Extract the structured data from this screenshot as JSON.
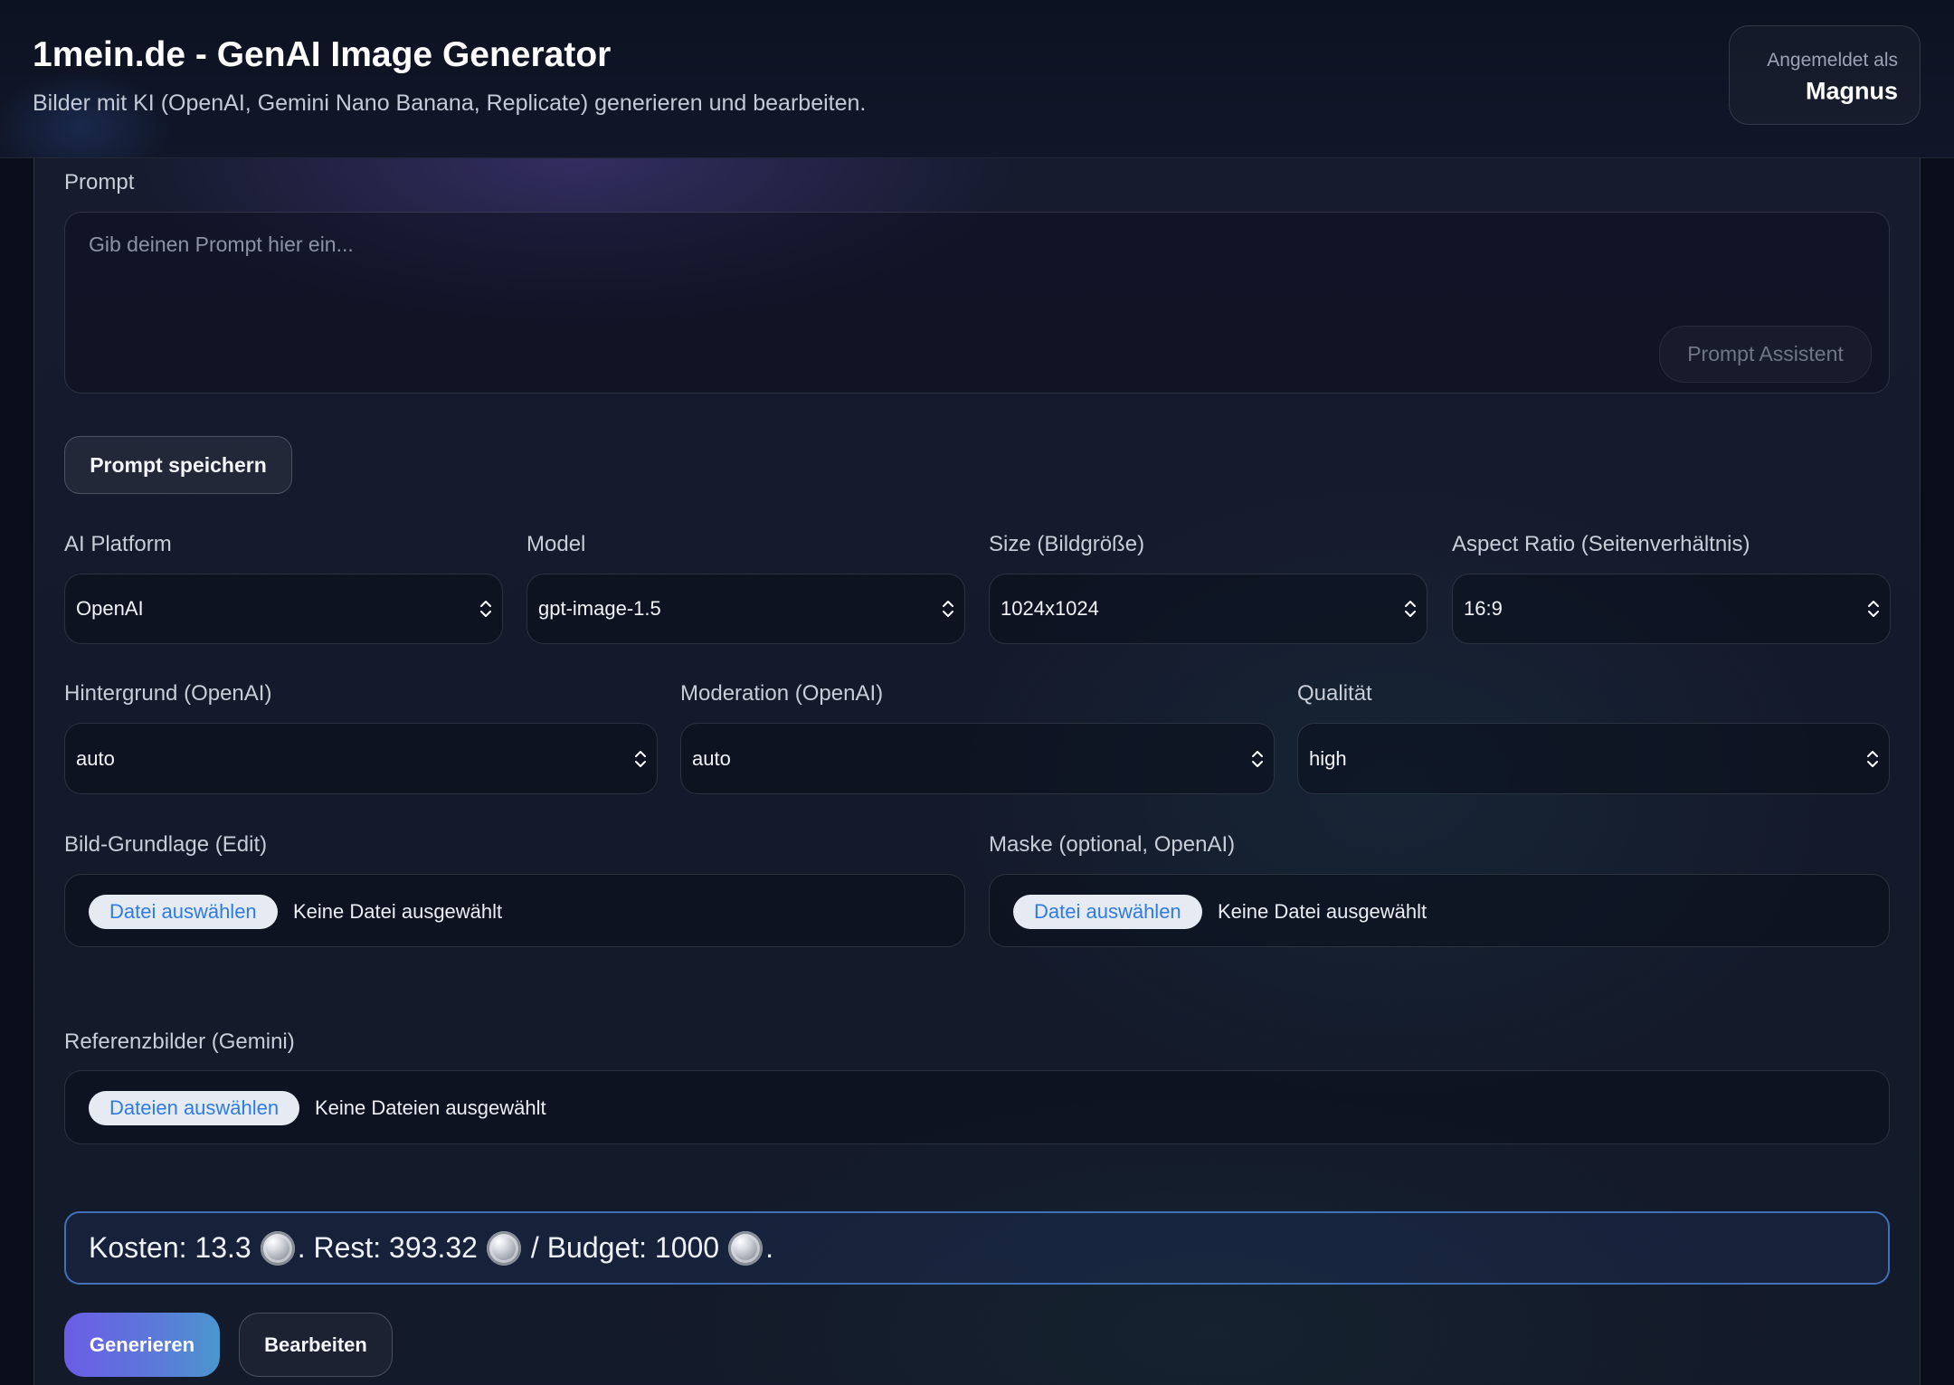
{
  "header": {
    "title": "1mein.de - GenAI Image Generator",
    "subtitle": "Bilder mit KI (OpenAI, Gemini Nano Banana, Replicate) generieren und bearbeiten.",
    "user_label": "Angemeldet als",
    "user_name": "Magnus"
  },
  "prompt": {
    "label": "Prompt",
    "placeholder": "Gib deinen Prompt hier ein...",
    "value": "",
    "assistant_button": "Prompt Assistent",
    "save_button": "Prompt speichern"
  },
  "settings": {
    "row1": [
      {
        "label": "AI Platform",
        "value": "OpenAI"
      },
      {
        "label": "Model",
        "value": "gpt-image-1.5"
      },
      {
        "label": "Size (Bildgröße)",
        "value": "1024x1024"
      },
      {
        "label": "Aspect Ratio (Seitenverhältnis)",
        "value": "16:9"
      }
    ],
    "row2": [
      {
        "label": "Hintergrund (OpenAI)",
        "value": "auto"
      },
      {
        "label": "Moderation (OpenAI)",
        "value": "auto"
      },
      {
        "label": "Qualität",
        "value": "high"
      }
    ]
  },
  "files": {
    "base": {
      "label": "Bild-Grundlage (Edit)",
      "button": "Datei auswählen",
      "status": "Keine Datei ausgewählt"
    },
    "mask": {
      "label": "Maske (optional, OpenAI)",
      "button": "Datei auswählen",
      "status": "Keine Datei ausgewählt"
    },
    "references": {
      "label": "Referenzbilder (Gemini)",
      "button": "Dateien auswählen",
      "status": "Keine Dateien ausgewählt"
    }
  },
  "cost": {
    "segments": [
      "Kosten: 13.3",
      ". Rest: 393.32",
      "/ Budget: 1000",
      "."
    ],
    "coin_icon": "silver-coin-icon"
  },
  "actions": {
    "generate": "Generieren",
    "edit": "Bearbeiten"
  },
  "colors": {
    "background": "#0a0e1b",
    "panel": "#141a2b",
    "accent_start": "#6c5ce6",
    "accent_end": "#4b96cf",
    "cost_border": "#4270b8",
    "file_button_text": "#2f7be0"
  }
}
